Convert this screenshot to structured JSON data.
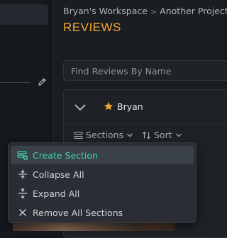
{
  "breadcrumb": {
    "workspace": "Bryan's Workspace",
    "separator": ">",
    "project": "Another Project"
  },
  "page": {
    "title": "REVIEWS"
  },
  "search": {
    "placeholder": "Find Reviews By Name",
    "value": ""
  },
  "panel": {
    "owner": "Bryan",
    "toolbar": {
      "sections_label": "Sections",
      "sort_label": "Sort"
    }
  },
  "menu": {
    "items": [
      {
        "label": "Create Section",
        "icon": "create-section-icon",
        "active": true
      },
      {
        "label": "Collapse All",
        "icon": "collapse-icon",
        "active": false
      },
      {
        "label": "Expand All",
        "icon": "expand-icon",
        "active": false
      },
      {
        "label": "Remove All Sections",
        "icon": "close-icon",
        "active": false
      }
    ]
  },
  "colors": {
    "accent": "#f0a531",
    "highlight": "#3fd3a8",
    "background": "#16191e",
    "menu_bg": "#2a2e34"
  }
}
